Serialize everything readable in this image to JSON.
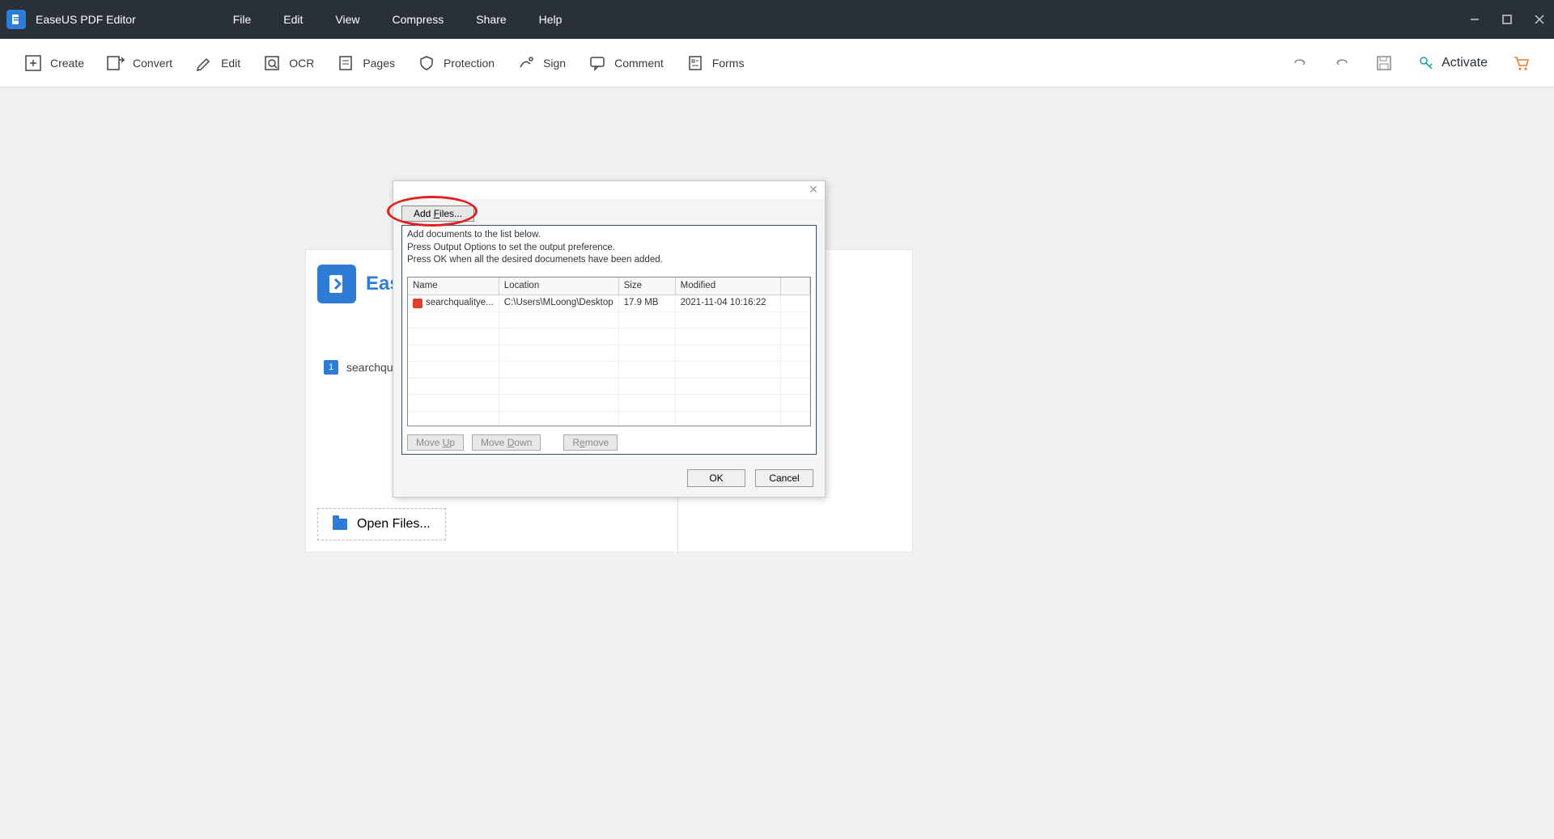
{
  "app": {
    "title": "EaseUS PDF Editor"
  },
  "menu": [
    "File",
    "Edit",
    "View",
    "Compress",
    "Share",
    "Help"
  ],
  "toolbar": {
    "create": "Create",
    "convert": "Convert",
    "edit": "Edit",
    "ocr": "OCR",
    "pages": "Pages",
    "protection": "Protection",
    "sign": "Sign",
    "comment": "Comment",
    "forms": "Forms",
    "activate": "Activate"
  },
  "start": {
    "brand": "EaseU",
    "recent_badge": "1",
    "recent_name": "searchquality",
    "open_files": "Open Files..."
  },
  "dialog": {
    "add_files": "Add Files...",
    "instructions": {
      "l1": "Add documents to the list below.",
      "l2": "Press Output Options to set the output preference.",
      "l3": "Press OK when all the desired documenets have been added."
    },
    "headers": {
      "name": "Name",
      "location": "Location",
      "size": "Size",
      "modified": "Modified"
    },
    "rows": [
      {
        "name": "searchqualitye...",
        "location": "C:\\Users\\MLoong\\Desktop",
        "size": "17.9 MB",
        "modified": "2021-11-04 10:16:22"
      }
    ],
    "move_up": "Move Up",
    "move_down": "Move Down",
    "remove": "Remove",
    "ok": "OK",
    "cancel": "Cancel"
  }
}
